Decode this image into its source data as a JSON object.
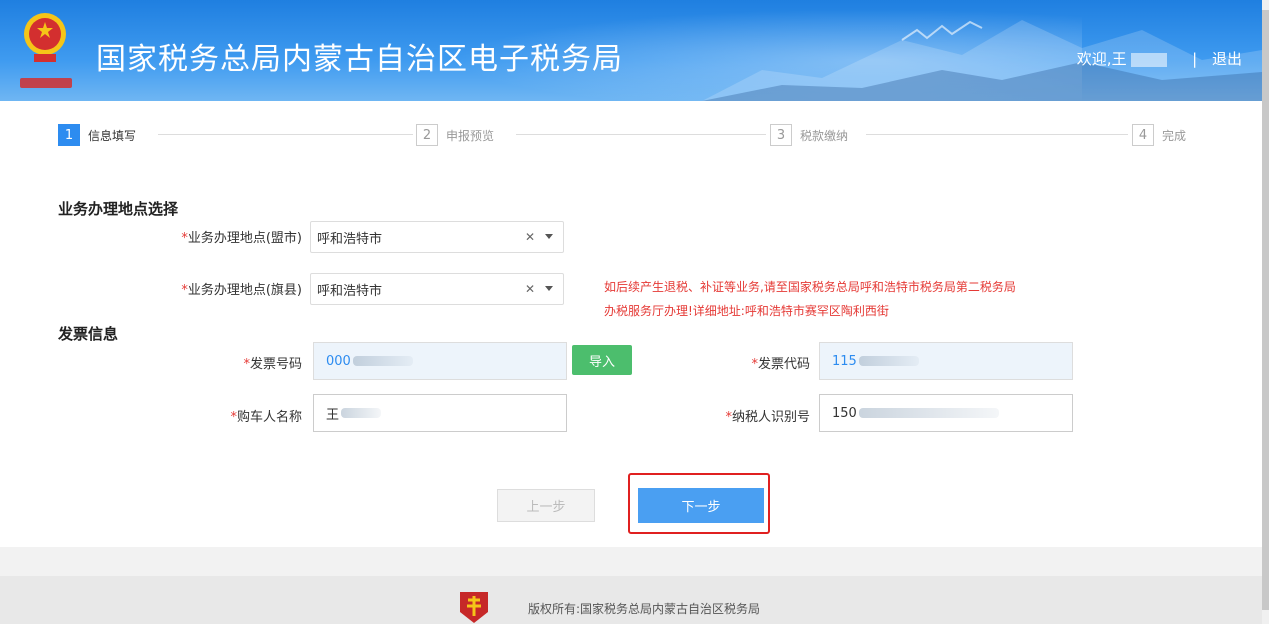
{
  "header": {
    "title": "国家税务总局内蒙古自治区电子税务局",
    "welcome": "欢迎,王",
    "logout": "退出",
    "emblem_text": "中国税务"
  },
  "steps": [
    {
      "num": "1",
      "label": "信息填写",
      "active": true
    },
    {
      "num": "2",
      "label": "申报预览",
      "active": false
    },
    {
      "num": "3",
      "label": "税款缴纳",
      "active": false
    },
    {
      "num": "4",
      "label": "完成",
      "active": false
    }
  ],
  "location": {
    "section_title": "业务办理地点选择",
    "city_label": "业务办理地点(盟市)",
    "city_value": "呼和浩特市",
    "county_label": "业务办理地点(旗县)",
    "county_value": "呼和浩特市",
    "notice_line1": "如后续产生退税、补证等业务,请至国家税务总局呼和浩特市税务局第二税务局",
    "notice_line2": "办税服务厅办理!详细地址:呼和浩特市赛罕区陶利西街"
  },
  "invoice": {
    "section_title": "发票信息",
    "number_label": "发票号码",
    "number_value": "000",
    "import_button": "导入",
    "code_label": "发票代码",
    "code_value": "115",
    "buyer_label": "购车人名称",
    "buyer_value": "王",
    "taxid_label": "纳税人识别号",
    "taxid_value": "150"
  },
  "actions": {
    "prev": "上一步",
    "next": "下一步"
  },
  "footer": {
    "copyright": "版权所有:国家税务总局内蒙古自治区税务局"
  },
  "colors": {
    "primary": "#2d8cf0",
    "header_blue": "#2a86e6",
    "required": "#e53935",
    "import_green": "#4cbe6d",
    "highlight_red": "#e02020"
  }
}
